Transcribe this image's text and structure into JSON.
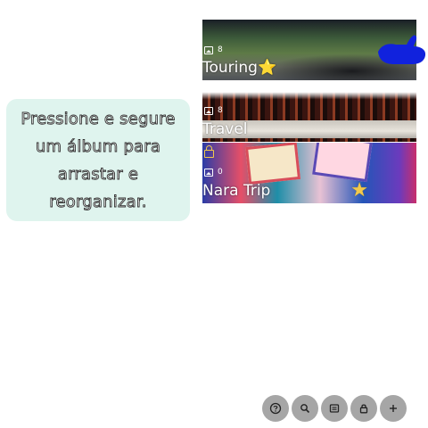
{
  "hint": {
    "text": "Pressione e segure um álbum para arrastar e reorganizar."
  },
  "albums": [
    {
      "title": "Touring⭐",
      "count": "8",
      "locked": false,
      "favorite": false
    },
    {
      "title": "Travel",
      "count": "8",
      "locked": false,
      "favorite": false
    },
    {
      "title": "Nara Trip",
      "count": "0",
      "locked": true,
      "favorite": true
    }
  ],
  "actions": [
    {
      "icon": "help-icon"
    },
    {
      "icon": "search-icon"
    },
    {
      "icon": "view-icon"
    },
    {
      "icon": "lock-icon"
    },
    {
      "icon": "add-icon"
    }
  ],
  "colors": {
    "hint_bg": "#dff4ee",
    "fab_bg": "#a6a6a6",
    "hand": "#1122dd",
    "star": "#f2c94c"
  }
}
